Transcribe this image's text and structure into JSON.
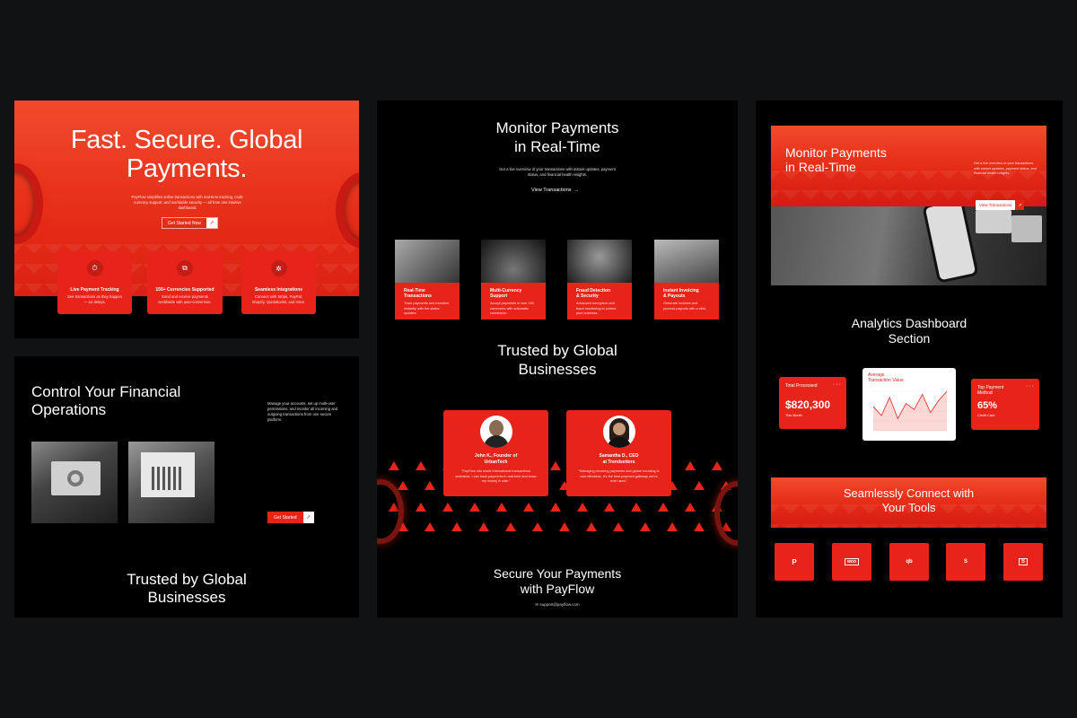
{
  "hero": {
    "title_line1": "Fast. Secure. Global",
    "title_line2": "Payments.",
    "desc": "PayFlow simplifies online transactions with real-time tracking, multi-currency support, and worldwide security — all from one intuitive dashboard.",
    "cta": "Get Started Now",
    "features": [
      {
        "title": "Live Payment Tracking",
        "desc": "See transactions as they happen — no delays."
      },
      {
        "title": "150+ Currencies Supported",
        "desc": "Send and receive payments worldwide with auto-conversion."
      },
      {
        "title": "Seamless Integrations",
        "desc": "Connect with Stripe, PayPal, Shopify, QuickBooks, and more."
      }
    ]
  },
  "control": {
    "title_line1": "Control Your Financial",
    "title_line2": "Operations",
    "desc": "Manage your accounts, set up multi-user permissions, and monitor all incoming and outgoing transactions from one secure platform.",
    "cta": "Get Started",
    "trusted_line1": "Trusted by Global",
    "trusted_line2": "Businesses"
  },
  "monitor": {
    "title_line1": "Monitor Payments",
    "title_line2": "in Real-Time",
    "desc": "Get a live overview of your transactions with instant updates, payment status, and financial health insights.",
    "cta": "View Transactions",
    "features": [
      {
        "title_line1": "Real-Time",
        "title_line2": "Transactions",
        "desc": "Track payments and transfers instantly with live status updates."
      },
      {
        "title_line1": "Multi-Currency",
        "title_line2": "Support",
        "desc": "Accept payments in over 150 currencies with automatic conversion."
      },
      {
        "title_line1": "Fraud Detection",
        "title_line2": "& Security",
        "desc": "Advanced encryption and fraud monitoring to protect your business."
      },
      {
        "title_line1": "Instant Invoicing",
        "title_line2": "& Payouts",
        "desc": "Generate invoices and process payouts with a click."
      }
    ],
    "trusted_line1": "Trusted by Global",
    "trusted_line2": "Businesses",
    "testimonials": [
      {
        "name_line1": "John K., Founder of",
        "name_line2": "UrbanTech",
        "quote": "“PayFlow has made international transactions seamless. I can track payments in real-time and know my money is safe.”"
      },
      {
        "name_line1": "Samantha D., CEO",
        "name_line2": "at Trendsetters",
        "quote": "“Managing recurring payments and global invoicing is now effortless. It’s the best payment gateway we’ve ever used.”"
      }
    ],
    "secure_line1": "Secure Your Payments",
    "secure_line2": "with PayFlow",
    "email": "support@payflow.com"
  },
  "right": {
    "title_line1": "Monitor Payments",
    "title_line2": "in Real-Time",
    "desc": "Get a live overview of your transactions with instant updates, payment status, and financial health insights.",
    "cta": "View Transactions",
    "analytics_line1": "Analytics Dashboard",
    "analytics_line2": "Section",
    "stats": [
      {
        "label": "Total Processed",
        "value": "$820,300",
        "sub": "This Month"
      },
      {
        "label_line1": "Top Payment",
        "label_line2": "Method",
        "value": "65%",
        "sub": "Credit Card"
      }
    ],
    "avg_line1": "Average",
    "avg_line2": "Transaction Value",
    "avg_chart": [
      40,
      25,
      55,
      20,
      45,
      35,
      60,
      30,
      50,
      65
    ],
    "connect_line1": "Seamlessly Connect with",
    "connect_line2": "Your Tools",
    "tools": [
      "P",
      "woo",
      "qb",
      "S",
      "S"
    ]
  },
  "colors": {
    "accent": "#e8231a",
    "bg": "#111214"
  }
}
